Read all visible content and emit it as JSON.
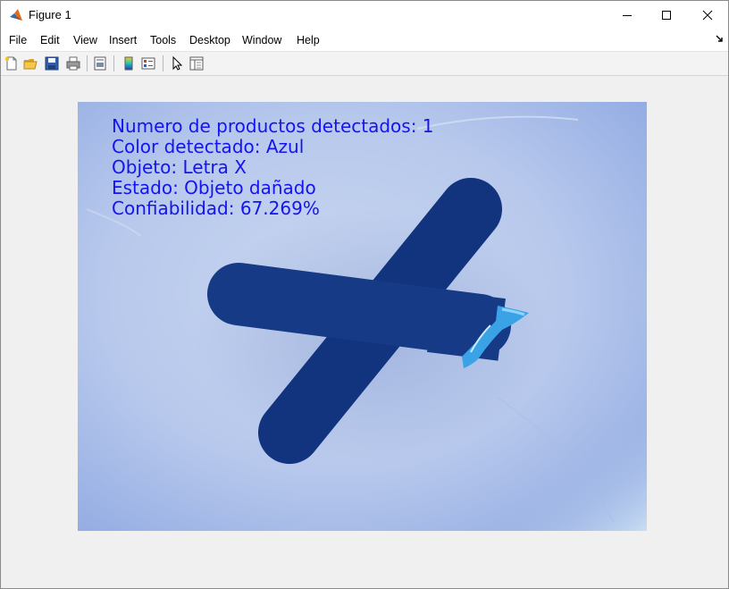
{
  "window": {
    "title": "Figure 1"
  },
  "menu": {
    "items": [
      "File",
      "Edit",
      "View",
      "Insert",
      "Tools",
      "Desktop",
      "Window",
      "Help"
    ]
  },
  "toolbar": {
    "icons": [
      "new-figure-icon",
      "open-file-icon",
      "save-icon",
      "print-icon",
      "print-preview-icon",
      "insert-colorbar-icon",
      "insert-legend-icon",
      "edit-plot-icon",
      "property-inspector-icon"
    ]
  },
  "figure": {
    "overlay_lines": [
      "Numero de productos detectados: 1",
      "Color detectado: Azul",
      "Objeto: Letra X",
      "Estado: Objeto dañado",
      "Confiabilidad: 67.269%"
    ],
    "text_color": "#1414f0"
  }
}
